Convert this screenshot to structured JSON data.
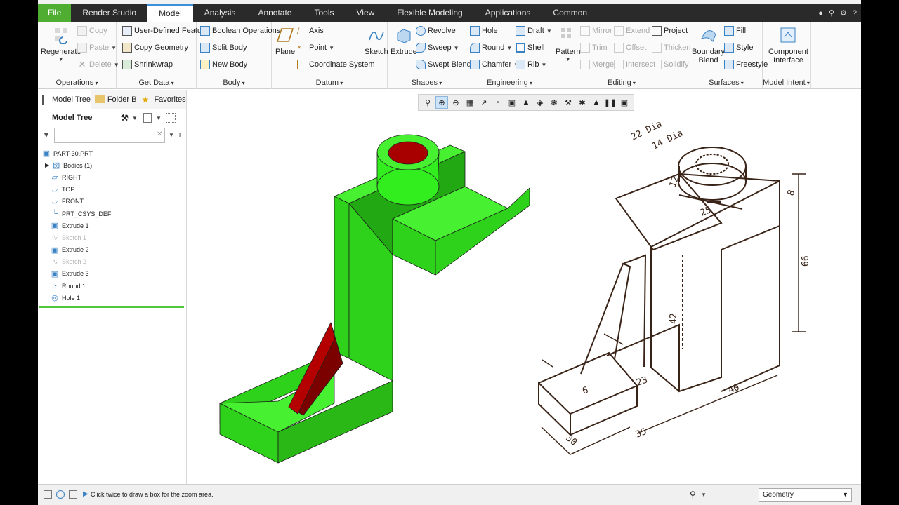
{
  "tabs": [
    {
      "label": "File"
    },
    {
      "label": "Render Studio"
    },
    {
      "label": "Model"
    },
    {
      "label": "Analysis"
    },
    {
      "label": "Annotate"
    },
    {
      "label": "Tools"
    },
    {
      "label": "View"
    },
    {
      "label": "Flexible Modeling"
    },
    {
      "label": "Applications"
    },
    {
      "label": "Common"
    }
  ],
  "ribbon": {
    "operations": {
      "label": "Operations",
      "regenerate": "Regenerate",
      "copy": "Copy",
      "paste": "Paste",
      "delete": "Delete"
    },
    "get_data": {
      "label": "Get Data",
      "udf": "User-Defined Feature",
      "copy_geometry": "Copy Geometry",
      "shrinkwrap": "Shrinkwrap"
    },
    "body": {
      "label": "Body",
      "boolean": "Boolean Operations",
      "split": "Split Body",
      "new": "New Body"
    },
    "datum": {
      "label": "Datum",
      "plane": "Plane",
      "axis": "Axis",
      "point": "Point",
      "csys": "Coordinate System",
      "sketch": "Sketch"
    },
    "shapes": {
      "label": "Shapes",
      "extrude": "Extrude",
      "revolve": "Revolve",
      "sweep": "Sweep",
      "swept_blend": "Swept Blend"
    },
    "engineering": {
      "label": "Engineering",
      "hole": "Hole",
      "round": "Round",
      "chamfer": "Chamfer",
      "draft": "Draft",
      "shell": "Shell",
      "rib": "Rib"
    },
    "editing": {
      "label": "Editing",
      "pattern": "Pattern",
      "mirror": "Mirror",
      "trim": "Trim",
      "merge": "Merge",
      "extend": "Extend",
      "offset": "Offset",
      "intersect": "Intersect",
      "project": "Project",
      "thicken": "Thicken",
      "solidify": "Solidify"
    },
    "surfaces": {
      "label": "Surfaces",
      "boundary": "Boundary",
      "blend": "Blend",
      "fill": "Fill",
      "style": "Style",
      "freestyle": "Freestyle"
    },
    "model_intent": {
      "label": "Model Intent",
      "component": "Component",
      "interface": "Interface"
    }
  },
  "panel": {
    "tabs": [
      {
        "label": "Model Tree"
      },
      {
        "label": "Folder Bro"
      },
      {
        "label": "Favorites"
      }
    ],
    "title": "Model Tree",
    "filter_placeholder": "",
    "items": [
      {
        "label": "PART-30.PRT",
        "icon": "part-icon",
        "suppressed": false
      },
      {
        "label": "Bodies (1)",
        "icon": "bodies-icon",
        "suppressed": false
      },
      {
        "label": "RIGHT",
        "icon": "datum-plane-icon",
        "suppressed": false
      },
      {
        "label": "TOP",
        "icon": "datum-plane-icon",
        "suppressed": false
      },
      {
        "label": "FRONT",
        "icon": "datum-plane-icon",
        "suppressed": false
      },
      {
        "label": "PRT_CSYS_DEF",
        "icon": "csys-icon",
        "suppressed": false
      },
      {
        "label": "Extrude 1",
        "icon": "extrude-icon",
        "suppressed": false
      },
      {
        "label": "Sketch 1",
        "icon": "sketch-icon",
        "suppressed": true
      },
      {
        "label": "Extrude 2",
        "icon": "extrude-icon",
        "suppressed": false
      },
      {
        "label": "Sketch 2",
        "icon": "sketch-icon",
        "suppressed": true
      },
      {
        "label": "Extrude 3",
        "icon": "extrude-icon",
        "suppressed": false
      },
      {
        "label": "Round 1",
        "icon": "round-icon",
        "suppressed": false
      },
      {
        "label": "Hole 1",
        "icon": "hole-icon",
        "suppressed": false
      }
    ]
  },
  "drawing": {
    "dims": [
      "22 Dia",
      "14 Dia",
      "12",
      "25",
      "8",
      "66",
      "42",
      "23",
      "6",
      "40",
      "30",
      "35"
    ]
  },
  "colors": {
    "model_green": "#33ee1f",
    "model_red": "#a40000",
    "accent": "#4fae32",
    "ink": "#3a2418"
  },
  "status": {
    "message": "Click twice to draw a box for the zoom area.",
    "filter_value": "Geometry"
  }
}
